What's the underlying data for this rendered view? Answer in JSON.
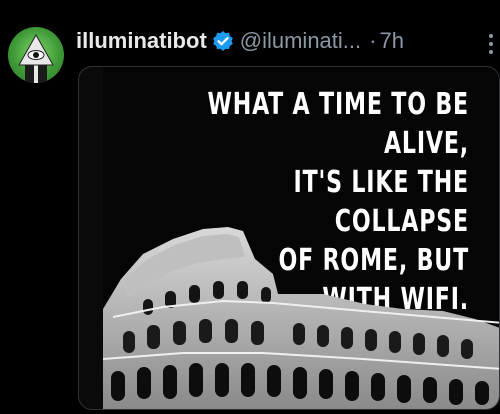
{
  "tweet": {
    "display_name": "illuminatibot",
    "handle": "@iluminati...",
    "separator": "·",
    "time": "7h",
    "verified": true
  },
  "media": {
    "quote_lines": [
      "WHAT A TIME TO BE ALIVE,",
      "IT'S LIKE THE COLLAPSE",
      "OF ROME, BUT",
      "WITH WIFI."
    ]
  },
  "colors": {
    "background": "#000000",
    "name": "#e7e9ea",
    "muted": "#8b98a5",
    "verified": "#1d9bf0",
    "avatar": "#3f9a37"
  },
  "icons": [
    "illuminati-eye-avatar",
    "verified-badge-icon",
    "more-options-icon"
  ]
}
